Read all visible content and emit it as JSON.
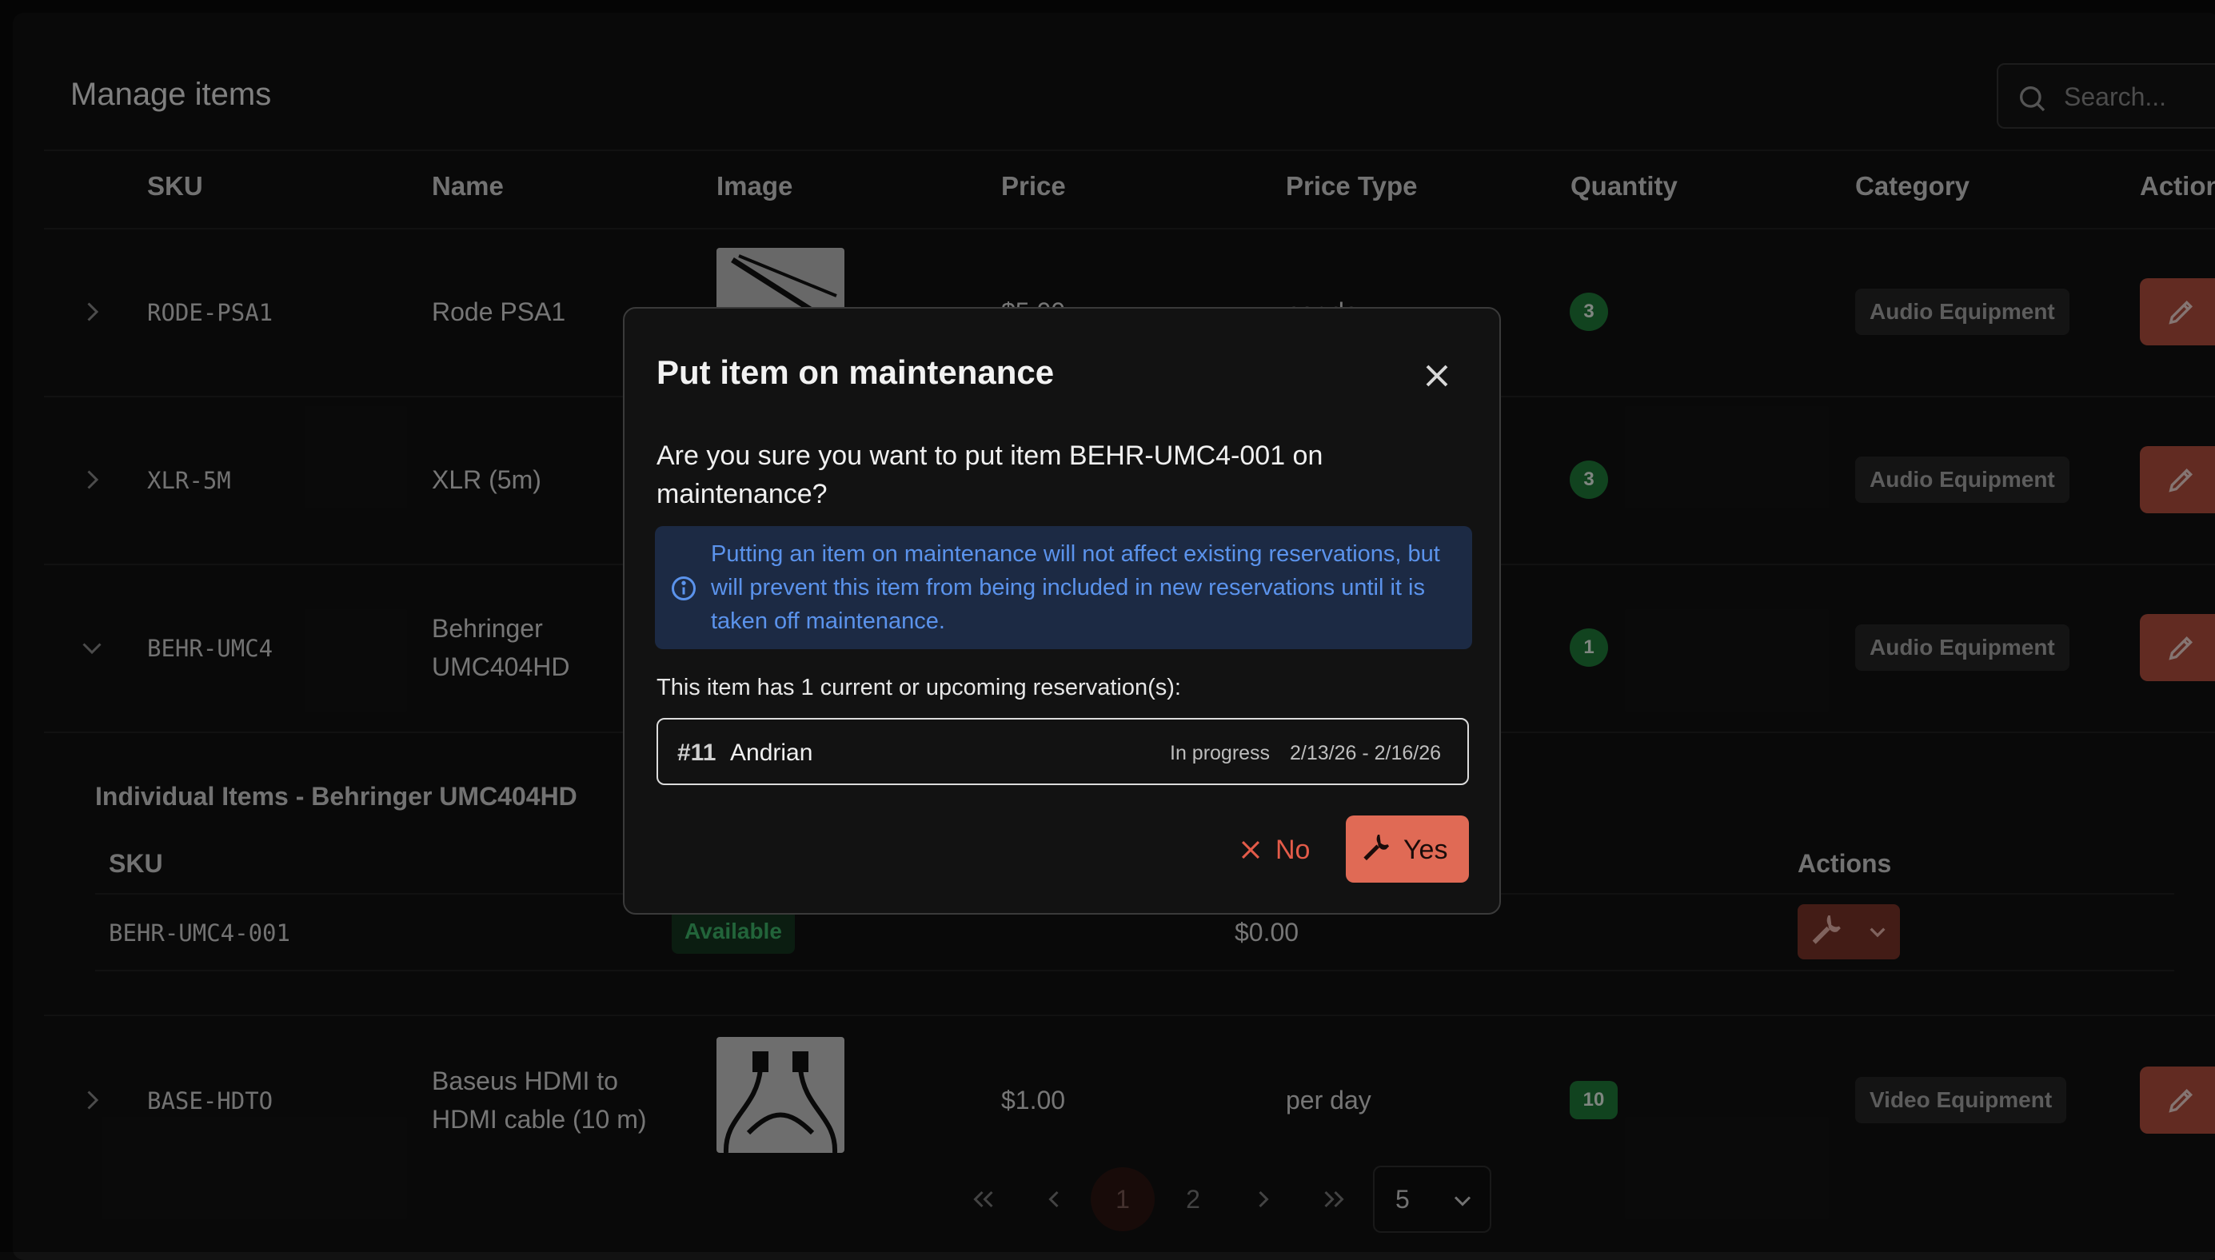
{
  "page": {
    "title": "Manage items",
    "search_placeholder": "Search..."
  },
  "table": {
    "columns": [
      "SKU",
      "Name",
      "Image",
      "Price",
      "Price Type",
      "Quantity",
      "Category",
      "Actions"
    ],
    "rows": [
      {
        "sku": "RODE-PSA1",
        "name": "Rode PSA1",
        "price": "$5.00",
        "price_type": "per day",
        "quantity": "3",
        "category": "Audio Equipment",
        "expanded": false
      },
      {
        "sku": "XLR-5M",
        "name": "XLR (5m)",
        "quantity": "3",
        "category": "Audio Equipment",
        "expanded": false
      },
      {
        "sku": "BEHR-UMC4",
        "name_line1": "Behringer",
        "name_line2": "UMC404HD",
        "quantity": "1",
        "category": "Audio Equipment",
        "expanded": true
      },
      {
        "sku": "BASE-HDTO",
        "name_line1": "Baseus HDMI to",
        "name_line2": "HDMI cable (10 m)",
        "price": "$1.00",
        "price_type": "per day",
        "quantity": "10",
        "category": "Video Equipment",
        "expanded": false
      }
    ]
  },
  "sub_table": {
    "title": "Individual Items - Behringer UMC404HD",
    "col_sku": "SKU",
    "col_actions": "Actions",
    "rows": [
      {
        "sku": "BEHR-UMC4-001",
        "status": "Available",
        "value": "$0.00"
      }
    ]
  },
  "pagination": {
    "pages": [
      "1",
      "2"
    ],
    "current": "1",
    "page_size": "5"
  },
  "modal": {
    "title": "Put item on maintenance",
    "question": "Are you sure you want to put item BEHR-UMC4-001 on maintenance?",
    "alert": "Putting an item on maintenance will not affect existing reservations, but will prevent this item from being included in new reservations until it is taken off maintenance.",
    "reservations_label": "This item has 1 current or upcoming reservation(s):",
    "reservation": {
      "id": "#11",
      "name": "Andrian",
      "status": "In progress",
      "dates": "2/13/26 - 2/16/26"
    },
    "no_label": "No",
    "yes_label": "Yes"
  },
  "colors": {
    "accent": "#e06a55",
    "badge_green": "#1f7a3a",
    "info_blue": "#5b93ec"
  }
}
